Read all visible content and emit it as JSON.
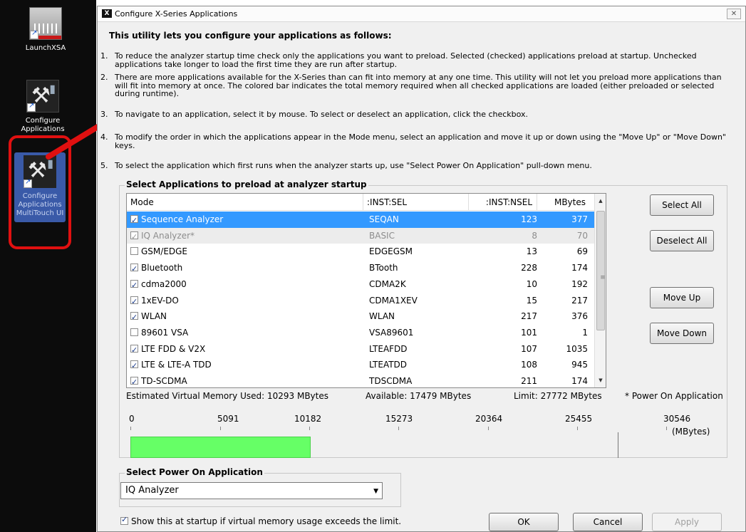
{
  "desktop": {
    "icons": [
      {
        "label": "LaunchXSA"
      },
      {
        "label": "Configure Applications"
      },
      {
        "label": "Configure Applications MultiTouch UI"
      }
    ]
  },
  "dialog": {
    "title": "Configure X-Series Applications",
    "close_glyph": "✕",
    "intro": "This utility lets you configure your applications as follows:",
    "steps": [
      {
        "num": "1.",
        "text": "To reduce the analyzer startup time check only the applications you want to preload. Selected (checked) applications preload at startup. Unchecked applications take longer to load the first time they are run after startup."
      },
      {
        "num": "2.",
        "text": "There are more applications available for the X-Series than can fit into memory at any one time. This utility will not let you preload more applications than will fit into memory at once. The colored bar indicates the total memory required when all checked applications are loaded (either preloaded or selected during runtime)."
      },
      {
        "num": "3.",
        "text": "To navigate to an application, select it by mouse. To select or deselect an application, click the checkbox."
      },
      {
        "num": "4.",
        "text": "To modify the order in which the applications appear in the Mode menu, select an application and move it up or down using the \"Move Up\" or \"Move Down\" keys."
      },
      {
        "num": "5.",
        "text": "To select the application which first runs when the analyzer starts up, use \"Select Power On Application\" pull-down menu."
      }
    ],
    "preload_group_label": "Select Applications to preload at analyzer startup",
    "table": {
      "headers": [
        "Mode",
        ":INST:SEL",
        ":INST:NSEL",
        "MBytes"
      ],
      "rows": [
        {
          "mode": "Sequence Analyzer",
          "inst": "SEQAN",
          "nsel": "123",
          "mb": "377",
          "checked": true,
          "selected": true
        },
        {
          "mode": "IQ Analyzer*",
          "inst": "BASIC",
          "nsel": "8",
          "mb": "70",
          "checked": true,
          "disabled": true
        },
        {
          "mode": "GSM/EDGE",
          "inst": "EDGEGSM",
          "nsel": "13",
          "mb": "69",
          "checked": false
        },
        {
          "mode": "Bluetooth",
          "inst": "BTooth",
          "nsel": "228",
          "mb": "174",
          "checked": true
        },
        {
          "mode": "cdma2000",
          "inst": "CDMA2K",
          "nsel": "10",
          "mb": "192",
          "checked": true
        },
        {
          "mode": "1xEV-DO",
          "inst": "CDMA1XEV",
          "nsel": "15",
          "mb": "217",
          "checked": true
        },
        {
          "mode": "WLAN",
          "inst": "WLAN",
          "nsel": "217",
          "mb": "376",
          "checked": true
        },
        {
          "mode": "89601 VSA",
          "inst": "VSA89601",
          "nsel": "101",
          "mb": "1",
          "checked": false
        },
        {
          "mode": "LTE FDD & V2X",
          "inst": "LTEAFDD",
          "nsel": "107",
          "mb": "1035",
          "checked": true
        },
        {
          "mode": "LTE & LTE-A TDD",
          "inst": "LTEATDD",
          "nsel": "108",
          "mb": "945",
          "checked": true
        },
        {
          "mode": "TD-SCDMA",
          "inst": "TDSCDMA",
          "nsel": "211",
          "mb": "174",
          "checked": true
        }
      ]
    },
    "buttons": {
      "select_all": "Select All",
      "deselect_all": "Deselect All",
      "move_up": "Move Up",
      "move_down": "Move Down",
      "ok": "OK",
      "cancel": "Cancel",
      "apply": "Apply"
    },
    "memory": {
      "used": "Estimated Virtual Memory Used: 10293 MBytes",
      "available": "Available: 17479 MBytes",
      "limit": "Limit: 27772 MBytes",
      "note": "* Power On Application",
      "ticks": [
        "0",
        "5091",
        "10182",
        "15273",
        "20364",
        "25455",
        "30546"
      ],
      "units": "(MBytes)",
      "used_mb": 10293,
      "limit_mb": 27772,
      "scale_max_mb": 30546,
      "bar_color": "#66ff66"
    },
    "power_on_group_label": "Select Power On Application",
    "power_on_value": "IQ Analyzer",
    "startup_checkbox_label": "Show this at startup if virtual memory usage exceeds the limit.",
    "startup_checked": true
  },
  "colors": {
    "selection": "#3399ff",
    "highlight_frame": "#e01010",
    "arrow": "#e01010"
  }
}
